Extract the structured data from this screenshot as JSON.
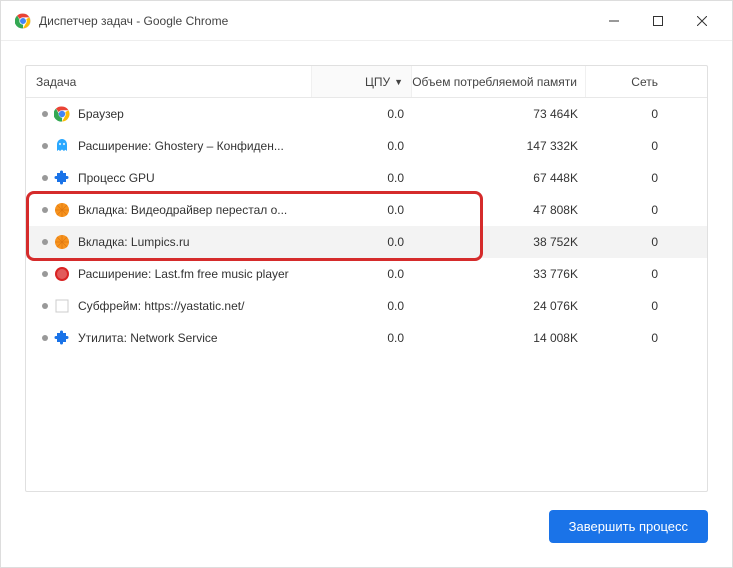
{
  "window": {
    "title": "Диспетчер задач - Google Chrome"
  },
  "columns": {
    "task": "Задача",
    "cpu": "ЦПУ",
    "memory": "Объем потребляемой памяти",
    "network": "Сеть",
    "sort_indicator": "▼"
  },
  "rows": [
    {
      "icon": "chrome",
      "task": "Браузер",
      "cpu": "0.0",
      "mem": "73 464K",
      "net": "0",
      "selected": false
    },
    {
      "icon": "ghostery",
      "task": "Расширение: Ghostery – Конфиден...",
      "cpu": "0.0",
      "mem": "147 332K",
      "net": "0",
      "selected": false
    },
    {
      "icon": "puzzle",
      "task": "Процесс GPU",
      "cpu": "0.0",
      "mem": "67 448K",
      "net": "0",
      "selected": false
    },
    {
      "icon": "orange",
      "task": "Вкладка: Видеодрайвер перестал о...",
      "cpu": "0.0",
      "mem": "47 808K",
      "net": "0",
      "selected": false
    },
    {
      "icon": "orange",
      "task": "Вкладка: Lumpics.ru",
      "cpu": "0.0",
      "mem": "38 752K",
      "net": "0",
      "selected": true
    },
    {
      "icon": "lastfm",
      "task": "Расширение: Last.fm free music player",
      "cpu": "0.0",
      "mem": "33 776K",
      "net": "0",
      "selected": false
    },
    {
      "icon": "blank",
      "task": "Субфрейм: https://yastatic.net/",
      "cpu": "0.0",
      "mem": "24 076K",
      "net": "0",
      "selected": false
    },
    {
      "icon": "puzzle",
      "task": "Утилита: Network Service",
      "cpu": "0.0",
      "mem": "14 008K",
      "net": "0",
      "selected": false
    }
  ],
  "footer": {
    "end_process": "Завершить процесс"
  },
  "icons": {
    "chrome": "chrome-icon",
    "ghostery": "ghostery-icon",
    "puzzle": "puzzle-icon",
    "orange": "orange-icon",
    "lastfm": "lastfm-icon",
    "blank": "blank-icon"
  }
}
